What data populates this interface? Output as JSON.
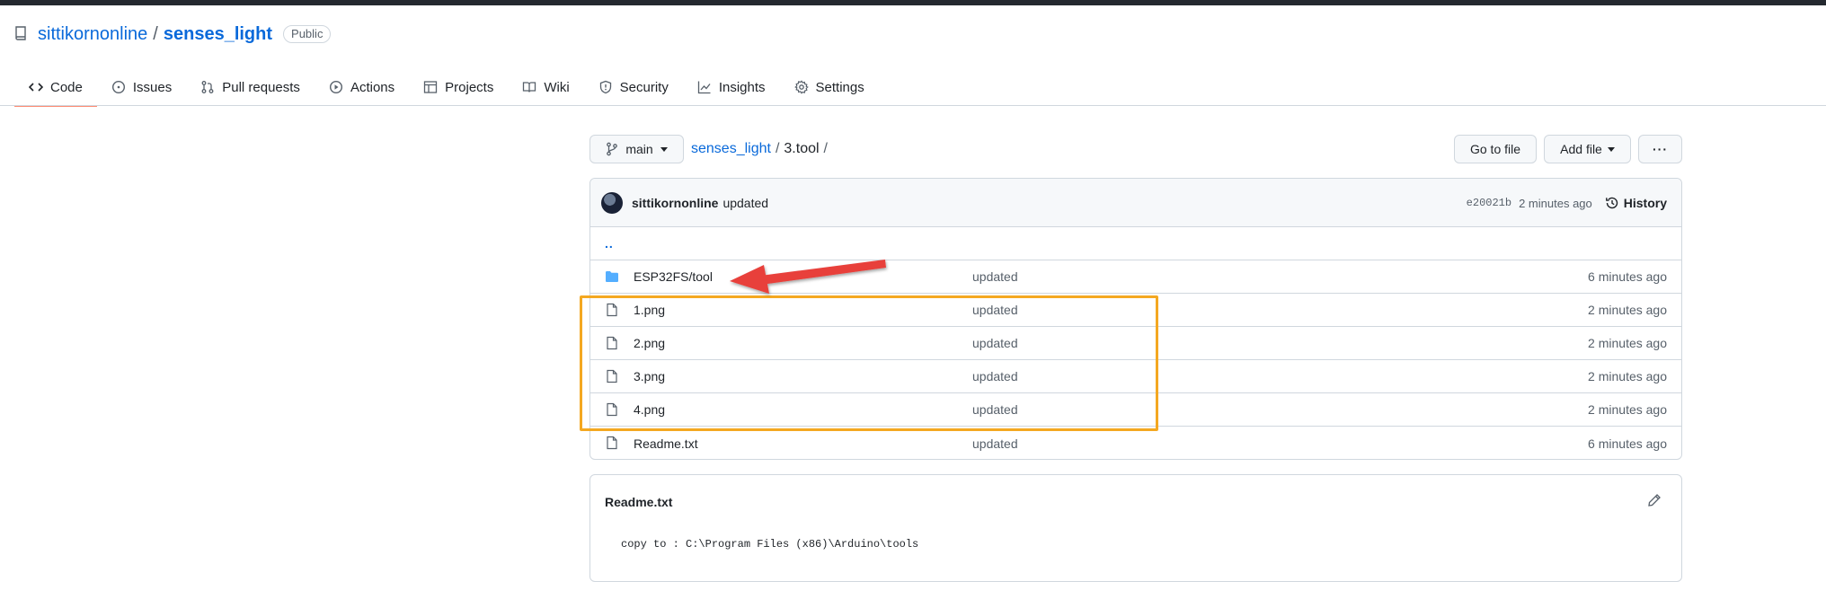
{
  "repo": {
    "owner": "sittikornonline",
    "separator": "/",
    "name": "senses_light",
    "visibility": "Public"
  },
  "tabs": [
    {
      "label": "Code",
      "icon": "code-icon",
      "active": true
    },
    {
      "label": "Issues",
      "icon": "issue-icon"
    },
    {
      "label": "Pull requests",
      "icon": "pull-request-icon"
    },
    {
      "label": "Actions",
      "icon": "play-icon"
    },
    {
      "label": "Projects",
      "icon": "table-icon"
    },
    {
      "label": "Wiki",
      "icon": "book-icon"
    },
    {
      "label": "Security",
      "icon": "shield-icon"
    },
    {
      "label": "Insights",
      "icon": "graph-icon"
    },
    {
      "label": "Settings",
      "icon": "gear-icon"
    }
  ],
  "toolbar": {
    "branch": "main",
    "breadcrumb_repo": "senses_light",
    "breadcrumb_sep": "/",
    "breadcrumb_dir": "3.tool",
    "breadcrumb_trail": "/",
    "goto_file": "Go to file",
    "add_file": "Add file",
    "more": "···"
  },
  "commit": {
    "author": "sittikornonline",
    "message": "updated",
    "sha": "e20021b",
    "age": "2 minutes ago",
    "history_label": "History"
  },
  "parent_dir": "..",
  "files": [
    {
      "name": "ESP32FS/tool",
      "type": "folder",
      "message": "updated",
      "age": "6 minutes ago"
    },
    {
      "name": "1.png",
      "type": "file",
      "message": "updated",
      "age": "2 minutes ago"
    },
    {
      "name": "2.png",
      "type": "file",
      "message": "updated",
      "age": "2 minutes ago"
    },
    {
      "name": "3.png",
      "type": "file",
      "message": "updated",
      "age": "2 minutes ago"
    },
    {
      "name": "4.png",
      "type": "file",
      "message": "updated",
      "age": "2 minutes ago"
    },
    {
      "name": "Readme.txt",
      "type": "file",
      "message": "updated",
      "age": "6 minutes ago"
    }
  ],
  "readme": {
    "title": "Readme.txt",
    "content": "copy to : C:\\Program Files (x86)\\Arduino\\tools"
  },
  "colors": {
    "link": "#0969da",
    "active_tab_underline": "#fd8c73",
    "highlight_box": "#f4a821",
    "arrow": "#e8403a",
    "folder": "#54aeff"
  }
}
